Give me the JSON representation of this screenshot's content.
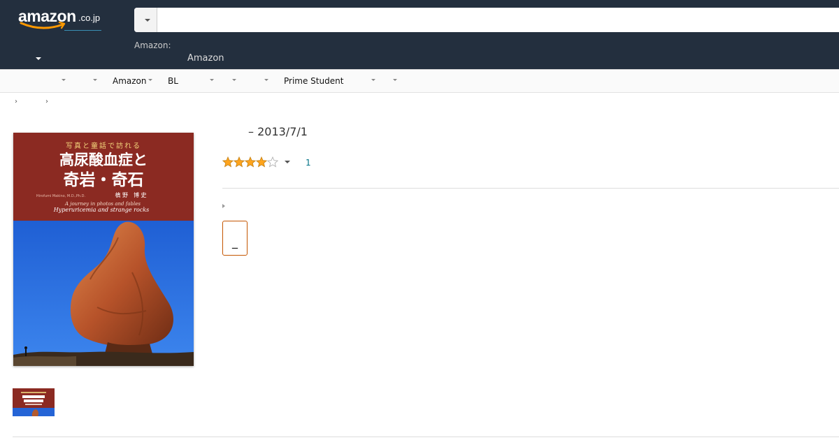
{
  "header": {
    "logo_text": "amazon",
    "logo_tld": ".co.jp",
    "search_placeholder": "",
    "small_label": "Amazon:",
    "amazon_label": "Amazon"
  },
  "subnav": {
    "items": [
      "",
      "",
      "Amazon",
      "BL",
      "",
      "",
      "Prime Student",
      "",
      ""
    ]
  },
  "breadcrumb": {
    "separator": "›"
  },
  "book": {
    "cover": {
      "series_line": "写真と童話で訪れる",
      "title_line1": "高尿酸血症と",
      "title_line2": "奇岩・奇石",
      "author_romaji": "Hirofumi Makino, M.D.,Ph.D.",
      "author_jp": "槙 野　博 史",
      "subtitle_en1": "A journey in photos and fables",
      "subtitle_en2": "Hyperuricemia and strange rocks"
    },
    "date": "– 2013/7/1",
    "rating": 4,
    "rating_max": 5,
    "review_count": "1",
    "format_label": "_"
  },
  "colors": {
    "header_bg": "#232f3e",
    "cover_red": "#8b2a22",
    "cover_blue": "#1f63d6",
    "star": "#ffa41c",
    "link": "#007185",
    "format_border": "#c45500"
  }
}
